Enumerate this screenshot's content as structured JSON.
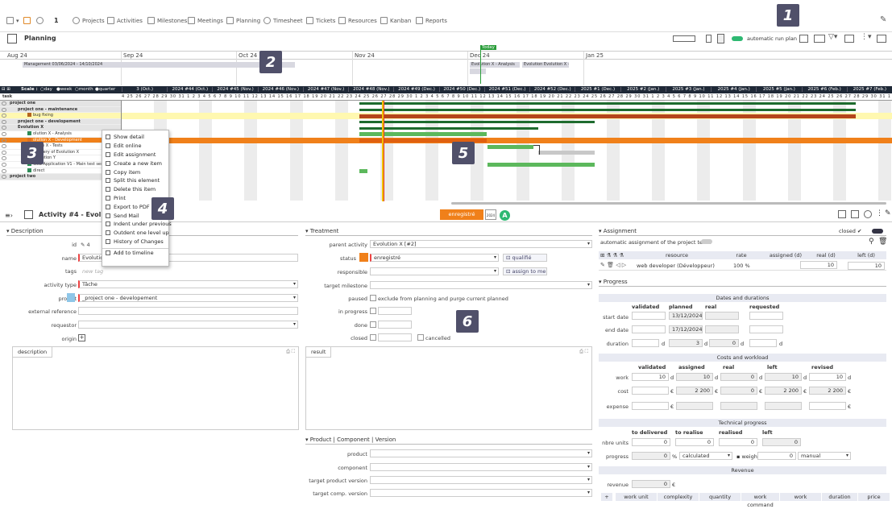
{
  "toolbar": {
    "count": "1",
    "items": [
      "Projects",
      "Activities",
      "Milestones",
      "Meetings",
      "Planning",
      "Timesheet",
      "Tickets",
      "Resources",
      "Kanban",
      "Reports"
    ]
  },
  "planning": {
    "title": "Planning",
    "auto_run_label": "automatic run plan",
    "today_label": "Today"
  },
  "timeline": {
    "months": [
      "Aug 24",
      "Sep 24",
      "Oct 24",
      "Nov 24",
      "Dec 24",
      "Jan 25"
    ],
    "bar1": "Management  03/06/2024 - 14/10/2024",
    "bar2": "Evolution X - Analysis",
    "bar3": "Evolution  Evolution X -"
  },
  "gantt": {
    "scale_label": "Scale :",
    "scale_options": [
      "day",
      "week",
      "month",
      "quarter"
    ],
    "task_header": "task",
    "weeks": [
      "3 (Oct.)",
      "2024 #44 (Oct.)",
      "2024 #45 (Nov.)",
      "2024 #46 (Nov.)",
      "2024 #47 (Nov.)",
      "2024 #48 (Nov.)",
      "2024 #49 (Dec.)",
      "2024 #50 (Dec.)",
      "2024 #51 (Dec.)",
      "2024 #52 (Dec.)",
      "2025 #1 (Dec.)",
      "2025 #2 (Jan.)",
      "2025 #3 (Jan.)",
      "2025 #4 (Jan.)",
      "2025 #5 (Jan.)",
      "2025 #6 (Feb.)",
      "2025 #7 (Feb.)"
    ],
    "days": "4 25 26 27 28 29 30 31 1 2 3 4 5 6 7 8 9 10 11 12 13 14 15 16 17 18 19 20 21 22 23 24 25 26 27 28 29 30 1 2 3 4 5 6 7 8 9 10 11 12 13 14 15 16 17 18 19 20 21 22 23 24 25 26 27 28 29 30 31 1 2 3 4 5 6 7 8 9 10 11 12 13 14 15 16 17 18 19 20 21 22 23 24 25 26 27 28 29 30 31 1 2 3 4 5 6 7 8 9 10 11 12 13 14 15",
    "tasks": [
      {
        "label": "project one",
        "color": "",
        "bold": true
      },
      {
        "label": "project one - maintenance",
        "color": "",
        "bold": true
      },
      {
        "label": "bug fixing",
        "color": "#b5651d",
        "bold": false
      },
      {
        "label": "project one - developement",
        "color": "",
        "bold": true
      },
      {
        "label": "Evolution X",
        "color": "",
        "bold": true
      },
      {
        "label": "olution X - Analysis",
        "color": "#2e8b57",
        "bold": false
      },
      {
        "label": "olution X - Development",
        "color": "#e07020",
        "bold": false
      },
      {
        "label": "lution X - Tests",
        "color": "#2e8b57",
        "bold": false
      },
      {
        "label": "Delivery of Evolution X",
        "color": "#2e8b57",
        "bold": false
      },
      {
        "label": "Evolution Y",
        "color": "#2e8b57",
        "bold": false
      },
      {
        "label": "Web Application V1 - Main test session",
        "color": "#2e8b57",
        "bold": false
      },
      {
        "label": "direct",
        "color": "#2e8b57",
        "bold": false
      },
      {
        "label": "project two",
        "color": "",
        "bold": true
      }
    ]
  },
  "context_menu": [
    "Show detail",
    "Edit online",
    "Edit assignment",
    "Create a new item",
    "Copy item",
    "Split this element",
    "Delete this item",
    "Print",
    "Export to PDF F",
    "Send Mail",
    "Indent under previous",
    "Outdent one level up",
    "History of Changes",
    "Add to timeline"
  ],
  "detail": {
    "title": "Activity  #4  - Evolu",
    "status_badge": "enregistré",
    "date_badge": "2024"
  },
  "description": {
    "section": "Description",
    "id_label": "id",
    "id_value": "4",
    "name_label": "name",
    "name_value": "Evolution",
    "tags_label": "tags",
    "tags_placeholder": "new tag",
    "activity_type_label": "activity type",
    "activity_type_value": "Tâche",
    "project_label": "project",
    "project_value": "_project one - developement",
    "ext_ref_label": "external reference",
    "requestor_label": "requestor",
    "origin_label": "origin",
    "desc_tab": "description"
  },
  "treatment": {
    "section": "Treatment",
    "parent_label": "parent activity",
    "parent_value": "Evolution X [#2]",
    "status_label": "status",
    "status_value": "enregistré",
    "qualified_btn": "qualifié",
    "responsible_label": "responsible",
    "assign_btn": "assign to me",
    "target_ms_label": "target milestone",
    "paused_label": "paused",
    "paused_text": "exclude from planning and purge current planned",
    "in_progress_label": "in progress",
    "done_label": "done",
    "closed_label": "closed",
    "cancelled_label": "cancelled",
    "result_tab": "result"
  },
  "product": {
    "section": "Product | Component | Version",
    "product_label": "product",
    "component_label": "component",
    "target_pv_label": "target product version",
    "target_cv_label": "target comp. version"
  },
  "assignment": {
    "section": "Assignment",
    "closed_label": "closed",
    "auto_label": "automatic assignment of the project team",
    "headers": [
      "resource",
      "rate",
      "assigned (d)",
      "real (d)",
      "left (d)"
    ],
    "row": {
      "resource": "web developer (Développeur)",
      "rate": "100 %",
      "assigned": "10",
      "real": "0,00",
      "left": "10"
    }
  },
  "progress": {
    "section": "Progress",
    "dates_header": "Dates and durations",
    "cols": [
      "validated",
      "planned",
      "real",
      "requested"
    ],
    "start_label": "start date",
    "start_planned": "13/12/2024",
    "end_label": "end date",
    "end_planned": "17/12/2024",
    "duration_label": "duration",
    "duration_planned": "3",
    "duration_real": "0",
    "d_unit": "d",
    "costs_header": "Costs and workload",
    "cost_cols": [
      "validated",
      "assigned",
      "real",
      "left",
      "revised"
    ],
    "work_label": "work",
    "work_values": [
      "10",
      "10",
      "0",
      "10",
      "10"
    ],
    "cost_label": "cost",
    "cost_values": [
      "",
      "2 200",
      "0",
      "2 200",
      "2 200"
    ],
    "expense_label": "expense",
    "euro": "€",
    "tech_header": "Technical progress",
    "tech_cols": [
      "to delivered",
      "to realise",
      "realised",
      "left"
    ],
    "units_label": "nbre units",
    "units_values": [
      "0",
      "0",
      "0",
      "0"
    ],
    "progress_label": "progress",
    "progress_value": "0",
    "percent": "%",
    "calc_value": "calculated",
    "weight_label": "weight",
    "weight_value": "0",
    "manual_value": "manual",
    "revenue_header": "Revenue",
    "revenue_label": "revenue",
    "revenue_value": "0",
    "wu_headers": [
      "work unit",
      "complexity",
      "quantity",
      "work command",
      "work",
      "duration",
      "price"
    ]
  },
  "badges": [
    "1",
    "2",
    "3",
    "4",
    "5",
    "6",
    "A"
  ],
  "colors": {
    "dark": "#1f2937",
    "green": "#5cb85c",
    "orange": "#f0801a",
    "darkgreen": "#1e6b2e",
    "rust": "#b5451b",
    "today": "#2a9d3a"
  }
}
